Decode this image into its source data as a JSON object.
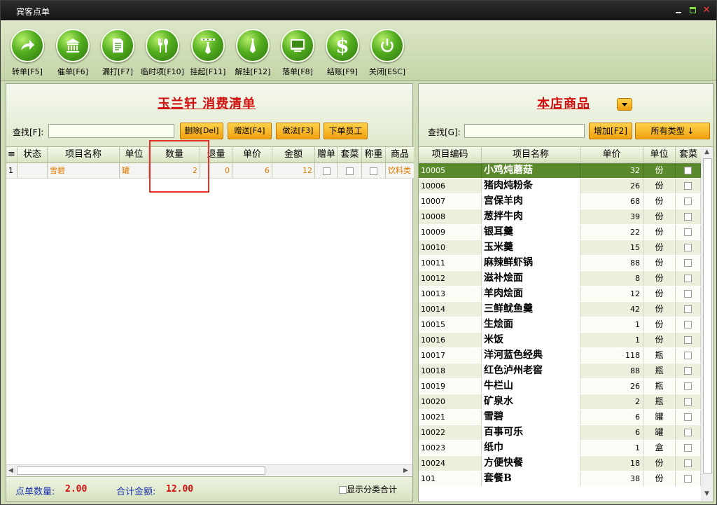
{
  "window": {
    "title": "宾客点单"
  },
  "toolbar": [
    {
      "label": "转单[F5]",
      "icon": "transfer-arrow-icon"
    },
    {
      "label": "催单[F6]",
      "icon": "bank-icon"
    },
    {
      "label": "漏打[F7]",
      "icon": "document-icon"
    },
    {
      "label": "临时项[F10]",
      "icon": "fork-spoon-icon"
    },
    {
      "label": "挂起[F11]",
      "icon": "tie-hanger-icon"
    },
    {
      "label": "解挂[F12]",
      "icon": "tie-icon"
    },
    {
      "label": "落单[F8]",
      "icon": "monitor-icon"
    },
    {
      "label": "结账[F9]",
      "icon": "dollar-icon"
    },
    {
      "label": "关闭[ESC]",
      "icon": "power-icon"
    }
  ],
  "left": {
    "title": "玉兰轩  消费清单",
    "search_label": "查找[F]:",
    "buttons": {
      "delete": "删除[Del]",
      "gift": "赠送[F4]",
      "method": "做法[F3]",
      "staff": "下单员工"
    },
    "columns": [
      "≡",
      "状态",
      "项目名称",
      "单位",
      "数量",
      "退量",
      "单价",
      "金额",
      "赠单",
      "套菜",
      "称重",
      "商品"
    ],
    "rows": [
      {
        "no": "1",
        "status": "",
        "name": "雪碧",
        "unit": "罐",
        "qty": "2",
        "ret": "0",
        "price": "6",
        "amount": "12",
        "category": "饮料类"
      }
    ],
    "footer": {
      "count_label": "点单数量:",
      "count_value": "2.00",
      "total_label": "合计金额:",
      "total_value": "12.00",
      "show_category_label": "显示分类合计"
    }
  },
  "right": {
    "title": "本店商品",
    "search_label": "查找[G]:",
    "add_button": "增加[F2]",
    "type_button": "所有类型 ↓",
    "columns": [
      "项目编码",
      "项目名称",
      "单价",
      "单位",
      "套菜"
    ],
    "rows": [
      {
        "code": "10005",
        "name": "小鸡炖蘑菇",
        "price": "32",
        "unit": "份"
      },
      {
        "code": "10006",
        "name": "猪肉炖粉条",
        "price": "26",
        "unit": "份"
      },
      {
        "code": "10007",
        "name": "宫保羊肉",
        "price": "68",
        "unit": "份"
      },
      {
        "code": "10008",
        "name": "葱拌牛肉",
        "price": "39",
        "unit": "份"
      },
      {
        "code": "10009",
        "name": "银耳羹",
        "price": "22",
        "unit": "份"
      },
      {
        "code": "10010",
        "name": "玉米羹",
        "price": "15",
        "unit": "份"
      },
      {
        "code": "10011",
        "name": "麻辣鲜虾锅",
        "price": "88",
        "unit": "份"
      },
      {
        "code": "10012",
        "name": "滋补烩面",
        "price": "8",
        "unit": "份"
      },
      {
        "code": "10013",
        "name": "羊肉烩面",
        "price": "12",
        "unit": "份"
      },
      {
        "code": "10014",
        "name": "三鲜鱿鱼羹",
        "price": "42",
        "unit": "份"
      },
      {
        "code": "10015",
        "name": "生烩面",
        "price": "1",
        "unit": "份"
      },
      {
        "code": "10016",
        "name": "米饭",
        "price": "1",
        "unit": "份"
      },
      {
        "code": "10017",
        "name": "洋河蓝色经典",
        "price": "118",
        "unit": "瓶"
      },
      {
        "code": "10018",
        "name": "红色泸州老窖",
        "price": "88",
        "unit": "瓶"
      },
      {
        "code": "10019",
        "name": "牛栏山",
        "price": "26",
        "unit": "瓶"
      },
      {
        "code": "10020",
        "name": "矿泉水",
        "price": "2",
        "unit": "瓶"
      },
      {
        "code": "10021",
        "name": "雪碧",
        "price": "6",
        "unit": "罐"
      },
      {
        "code": "10022",
        "name": "百事可乐",
        "price": "6",
        "unit": "罐"
      },
      {
        "code": "10023",
        "name": "纸巾",
        "price": "1",
        "unit": "盒"
      },
      {
        "code": "10024",
        "name": "方便快餐",
        "price": "18",
        "unit": "份"
      },
      {
        "code": "101",
        "name": "套餐B",
        "price": "38",
        "unit": "份"
      }
    ]
  },
  "colors": {
    "accent_green": "#5b8a2c",
    "title_red": "#d01010",
    "button_yellow": "#f0a010",
    "highlight_box": "#e8302a"
  }
}
